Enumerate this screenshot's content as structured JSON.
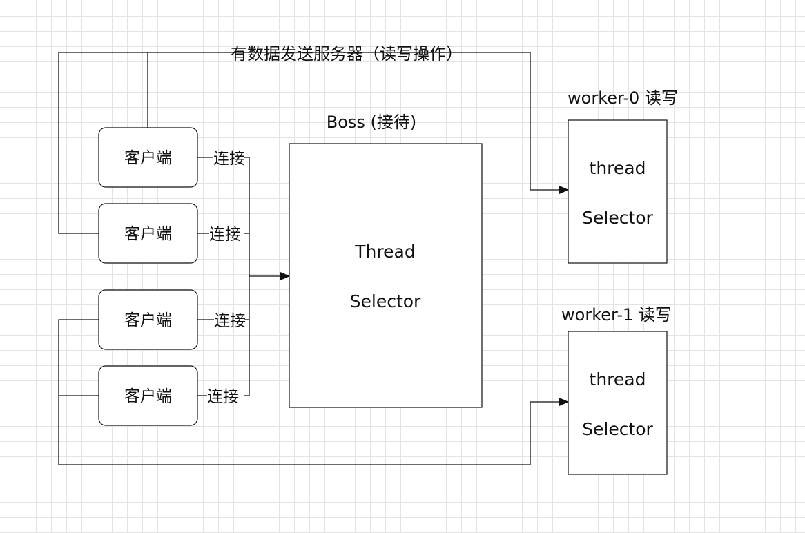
{
  "diagram": {
    "top_connection_label": "有数据发送服务器（读写操作）",
    "clients": [
      {
        "label": "客户端",
        "connect_label": "连接"
      },
      {
        "label": "客户端",
        "connect_label": "连接"
      },
      {
        "label": "客户端",
        "connect_label": "连接"
      },
      {
        "label": "客户端",
        "connect_label": "连接"
      }
    ],
    "boss": {
      "title": "Boss (接待)",
      "line1": "Thread",
      "line2": "Selector"
    },
    "workers": [
      {
        "title": "worker-0 读写",
        "line1": "thread",
        "line2": "Selector"
      },
      {
        "title": "worker-1 读写",
        "line1": "thread",
        "line2": "Selector"
      }
    ]
  }
}
